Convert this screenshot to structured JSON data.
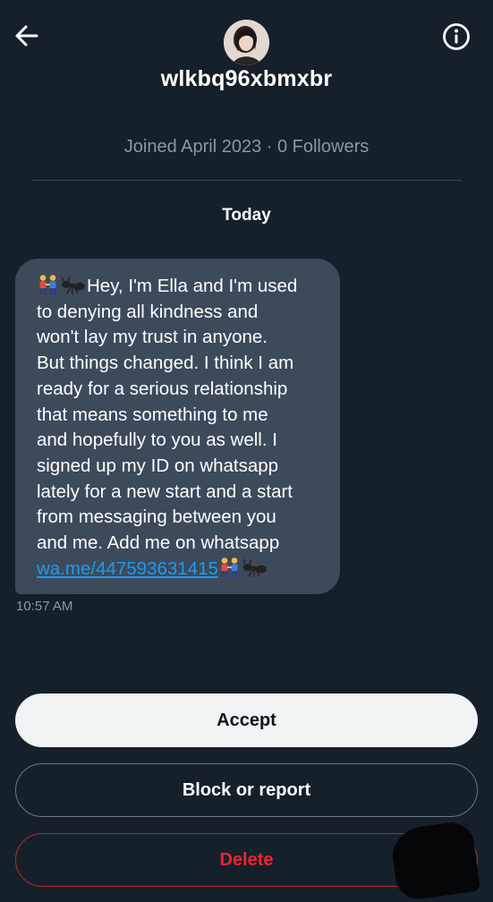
{
  "header": {
    "back_icon": "arrow-left-icon",
    "info_icon": "info-circle-icon",
    "avatar_icon": "profile-avatar",
    "username": "wlkbq96xbmxbr",
    "joined_text": "Joined April 2023 · 0 Followers"
  },
  "conversation": {
    "day_label": "Today",
    "message": {
      "emoji_start": [
        "couple-icon",
        "ant-icon"
      ],
      "lines": [
        "Hey, I'm Ella and I'm used",
        "to denying all kindness and",
        "won't lay my trust in anyone.",
        "But things changed. I think I am",
        "ready for a serious relationship",
        "that means something to me",
        "and hopefully to you as well. I",
        "signed up my ID on whatsapp",
        "lately for a new start and a start",
        "from messaging between you",
        "and me. Add me on whatsapp"
      ],
      "link_text": "wa.me/447593631415",
      "emoji_end": [
        "couple-icon",
        "ant-icon"
      ],
      "timestamp": "10:57 AM"
    }
  },
  "actions": {
    "accept_label": "Accept",
    "block_label": "Block or report",
    "delete_label": "Delete"
  },
  "colors": {
    "background": "#15202b",
    "bubble": "#3d4a5a",
    "link": "#1d9bf0",
    "delete": "#f4212e"
  }
}
